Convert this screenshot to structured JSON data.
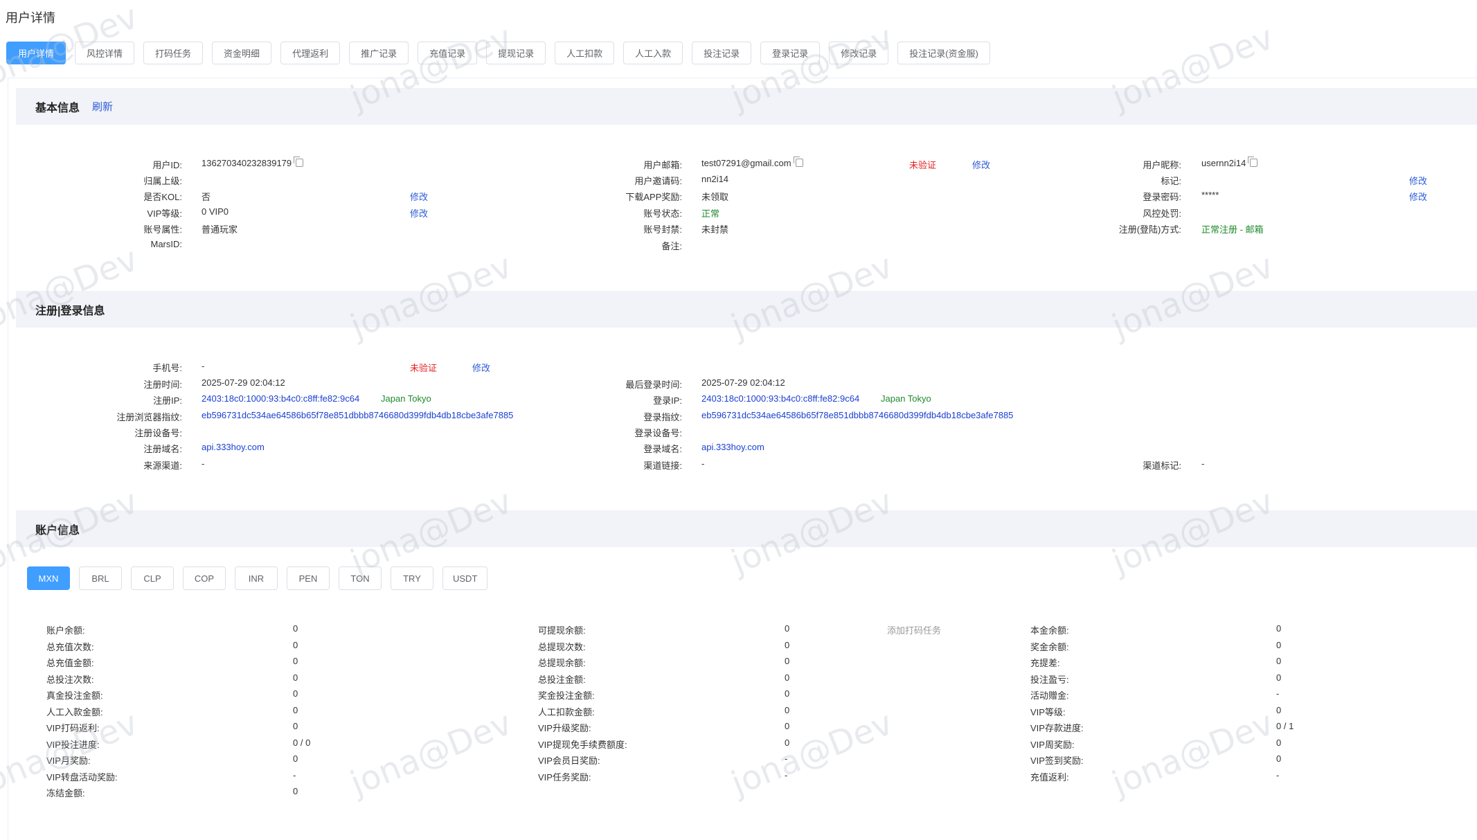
{
  "page_title": "用户详情",
  "tabs": [
    "用户详情",
    "风控详情",
    "打码任务",
    "资金明细",
    "代理返利",
    "推广记录",
    "充值记录",
    "提现记录",
    "人工扣款",
    "人工入款",
    "投注记录",
    "登录记录",
    "修改记录",
    "投注记录(资金服)"
  ],
  "watermark": "jona@Dev",
  "basic": {
    "title": "基本信息",
    "refresh": "刷新",
    "user_id_label": "用户ID:",
    "user_id": "136270340232839179",
    "parent_label": "归属上级:",
    "kol_label": "是否KOL:",
    "kol": "否",
    "kol_edit": "修改",
    "vip_label": "VIP等级:",
    "vip": "0 VIP0",
    "vip_edit": "修改",
    "acct_attr_label": "账号属性:",
    "acct_attr": "普通玩家",
    "mars_label": "MarsID:",
    "email_label": "用户邮箱:",
    "email": "test07291@gmail.com",
    "email_status": "未验证",
    "email_edit": "修改",
    "invite_label": "用户邀请码:",
    "invite": "nn2i14",
    "app_reward_label": "下载APP奖励:",
    "app_reward": "未领取",
    "status_label": "账号状态:",
    "status": "正常",
    "ban_label": "账号封禁:",
    "ban": "未封禁",
    "note_label": "备注:",
    "nickname_label": "用户昵称:",
    "nickname": "usernn2i14",
    "tag_label": "标记:",
    "tag_edit": "修改",
    "pwd_label": "登录密码:",
    "pwd": "*****",
    "pwd_edit": "修改",
    "risk_label": "风控处罚:",
    "reg_method_label": "注册(登陆)方式:",
    "reg_method": "正常注册 - 邮箱"
  },
  "reg": {
    "title": "注册|登录信息",
    "phone_label": "手机号:",
    "phone": "-",
    "phone_status": "未验证",
    "phone_edit": "修改",
    "reg_time_label": "注册时间:",
    "reg_time": "2025-07-29 02:04:12",
    "reg_ip_label": "注册IP:",
    "reg_ip": "2403:18c0:1000:93:b4c0:c8ff:fe82:9c64",
    "reg_ip_loc": "Japan Tokyo",
    "reg_fp_label": "注册浏览器指纹:",
    "reg_fp": "eb596731dc534ae64586b65f78e851dbbb8746680d399fdb4db18cbe3afe7885",
    "reg_device_label": "注册设备号:",
    "reg_domain_label": "注册域名:",
    "reg_domain": "api.333hoy.com",
    "source_label": "来源渠道:",
    "source": "-",
    "last_login_label": "最后登录时间:",
    "last_login": "2025-07-29 02:04:12",
    "login_ip_label": "登录IP:",
    "login_ip": "2403:18c0:1000:93:b4c0:c8ff:fe82:9c64",
    "login_ip_loc": "Japan Tokyo",
    "login_fp_label": "登录指纹:",
    "login_fp": "eb596731dc534ae64586b65f78e851dbbb8746680d399fdb4db18cbe3afe7885",
    "login_device_label": "登录设备号:",
    "login_domain_label": "登录域名:",
    "login_domain": "api.333hoy.com",
    "channel_link_label": "渠道链接:",
    "channel_link": "-",
    "channel_tag_label": "渠道标记:",
    "channel_tag": "-"
  },
  "account": {
    "title": "账户信息",
    "currencies": [
      "MXN",
      "BRL",
      "CLP",
      "COP",
      "INR",
      "PEN",
      "TON",
      "TRY",
      "USDT"
    ],
    "add_task": "添加打码任务",
    "col1": [
      {
        "label": "账户余额:",
        "value": "0"
      },
      {
        "label": "总充值次数:",
        "value": "0"
      },
      {
        "label": "总充值金额:",
        "value": "0"
      },
      {
        "label": "总投注次数:",
        "value": "0"
      },
      {
        "label": "真金投注金额:",
        "value": "0"
      },
      {
        "label": "人工入款金额:",
        "value": "0"
      },
      {
        "label": "VIP打码返利:",
        "value": "0"
      },
      {
        "label": "VIP投注进度:",
        "value": "0 / 0"
      },
      {
        "label": "VIP月奖励:",
        "value": "0"
      },
      {
        "label": "VIP转盘活动奖励:",
        "value": "-"
      },
      {
        "label": "冻结金额:",
        "value": "0"
      }
    ],
    "col2": [
      {
        "label": "可提现余额:",
        "value": "0"
      },
      {
        "label": "总提现次数:",
        "value": "0"
      },
      {
        "label": "总提现余额:",
        "value": "0"
      },
      {
        "label": "总投注金额:",
        "value": "0"
      },
      {
        "label": "奖金投注金额:",
        "value": "0"
      },
      {
        "label": "人工扣款金额:",
        "value": "0"
      },
      {
        "label": "VIP升级奖励:",
        "value": "0"
      },
      {
        "label": "VIP提现免手续费额度:",
        "value": "0"
      },
      {
        "label": "VIP会员日奖励:",
        "value": "-"
      },
      {
        "label": "VIP任务奖励:",
        "value": "-"
      }
    ],
    "col3": [
      {
        "label": "本金余额:",
        "value": "0"
      },
      {
        "label": "奖金余额:",
        "value": "0"
      },
      {
        "label": "充提差:",
        "value": "0"
      },
      {
        "label": "投注盈亏:",
        "value": "0"
      },
      {
        "label": "活动赠金:",
        "value": "-"
      },
      {
        "label": "VIP等级:",
        "value": "0"
      },
      {
        "label": "VIP存款进度:",
        "value": "0 / 1"
      },
      {
        "label": "VIP周奖励:",
        "value": "0"
      },
      {
        "label": "VIP签到奖励:",
        "value": "0"
      },
      {
        "label": "充值返利:",
        "value": "-"
      }
    ]
  }
}
